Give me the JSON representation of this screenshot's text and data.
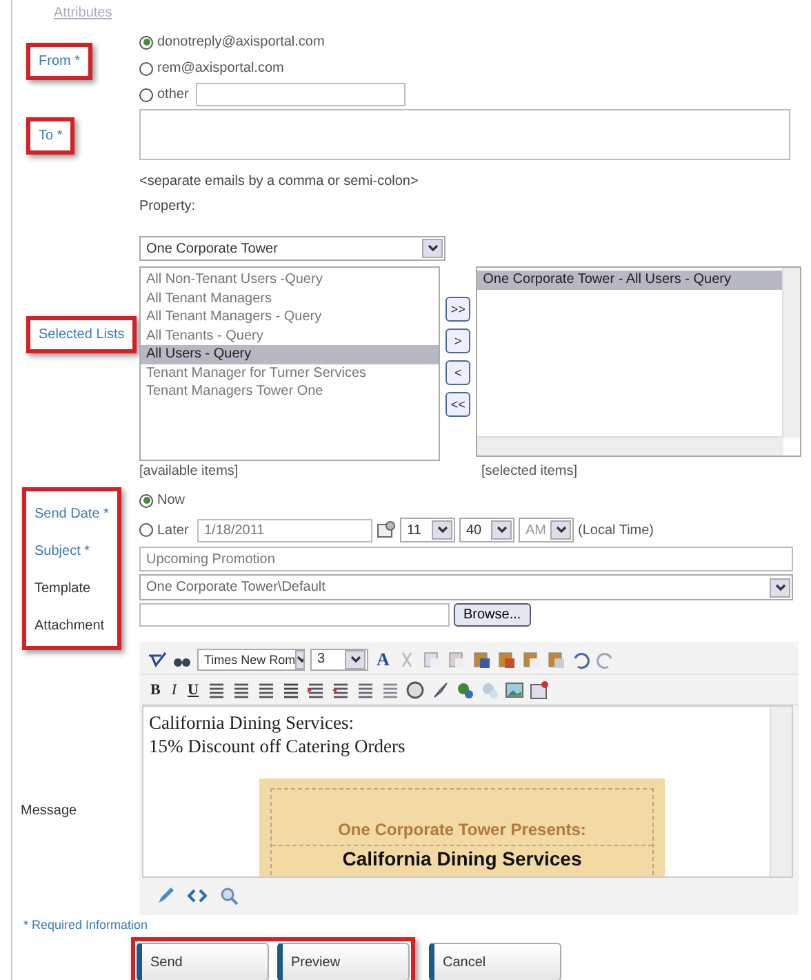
{
  "attributes_link": "Attributes",
  "from": {
    "label": "From *",
    "required": true,
    "highlighted": true,
    "options": [
      {
        "label": "donotreply@axisportal.com",
        "selected": true
      },
      {
        "label": "rem@axisportal.com",
        "selected": false
      },
      {
        "label": "other",
        "selected": false,
        "kind": "with-field"
      }
    ]
  },
  "to": {
    "label": "To *",
    "required": true,
    "highlighted": true,
    "hint": "<separate emails by a comma or semi-colon>"
  },
  "property": {
    "label": "Property:",
    "value": "One Corporate Tower"
  },
  "lists": {
    "label": "Selected Lists",
    "required": true,
    "highlighted": true,
    "available": [
      {
        "label": "All Non-Tenant Users -Query",
        "selected": false
      },
      {
        "label": "All Tenant Managers",
        "selected": false
      },
      {
        "label": "All Tenant Managers - Query",
        "selected": false
      },
      {
        "label": "All Tenants - Query",
        "selected": false
      },
      {
        "label": "All Users - Query",
        "selected": true
      },
      {
        "label": "Tenant Manager for Turner Services",
        "selected": false
      },
      {
        "label": "Tenant Managers Tower One",
        "selected": false
      }
    ],
    "transfer_buttons": [
      ">>",
      ">",
      "<",
      "<<"
    ],
    "selected_items": [
      {
        "label": "One Corporate Tower - All Users - Query",
        "selected": true
      }
    ],
    "available_caption": "[available items]",
    "selected_caption": "[selected items]"
  },
  "details": {
    "highlighted": true,
    "labels": [
      {
        "label": "Send Date *",
        "required": true
      },
      {
        "label": "Subject *",
        "required": true
      },
      {
        "label": "Template",
        "required": false
      },
      {
        "label": "Attachment",
        "required": false
      }
    ],
    "send_options": [
      {
        "label": "Now",
        "selected": true
      },
      {
        "label": "Later",
        "selected": false
      }
    ],
    "date": "1/18/2011",
    "hour": "11",
    "minute": "40",
    "ampm": "AM",
    "time_note": "(Local Time)",
    "subject": "Upcoming Promotion",
    "template": "One Corporate Tower\\Default",
    "browse": "Browse..."
  },
  "editor": {
    "label": "Message",
    "font": "Times New Rom",
    "size": "3",
    "color_button": "A",
    "format_buttons": [
      "B",
      "I",
      "U"
    ],
    "lines": [
      "California Dining Services:",
      "15% Discount off Catering Orders"
    ],
    "banner_heading": "One Corporate Tower Presents:",
    "banner_title": "California Dining Services"
  },
  "required_note": "* Required Information",
  "button_groups": [
    {
      "highlighted": true,
      "buttons": [
        "Send",
        "Preview"
      ]
    },
    {
      "highlighted": false,
      "buttons": [
        "Cancel"
      ]
    }
  ]
}
